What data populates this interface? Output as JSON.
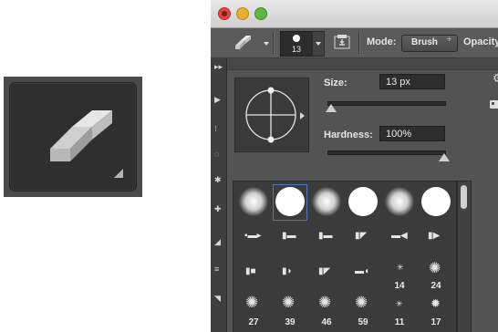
{
  "options_bar": {
    "brush_size": "13",
    "mode_label": "Mode:",
    "mode_value": "Brush",
    "mode_arrows": "÷",
    "opacity_label": "Opacity"
  },
  "brush_panel": {
    "size_label": "Size:",
    "size_value": "13 px",
    "hardness_label": "Hardness:",
    "hardness_value": "100%",
    "size_slider_fraction": 0.03,
    "hardness_slider_fraction": 1.0
  },
  "presets": {
    "numbers_row3": [
      "",
      "",
      "",
      "",
      "14",
      "24"
    ],
    "numbers_row4": [
      "27",
      "39",
      "46",
      "59",
      "11",
      "17"
    ]
  },
  "icons": [
    "eraser-icon",
    "brush-panel-icon",
    "gear-icon",
    "new-preset-icon"
  ],
  "colors": {
    "panel": "#535353",
    "selected_border": "#4a78c4"
  }
}
